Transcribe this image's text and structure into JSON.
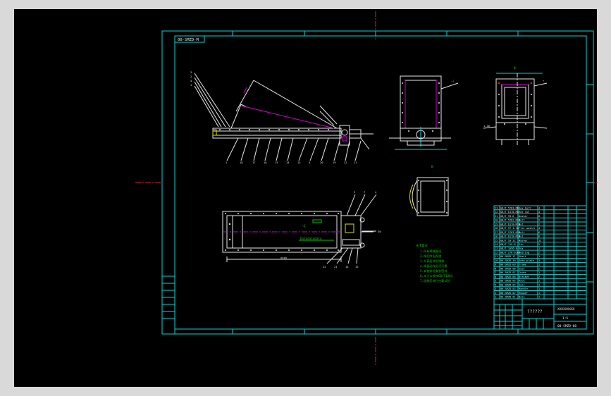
{
  "frame": {
    "label": "00-SMZD-M"
  },
  "bom": {
    "rows": [
      {
        "num": "23",
        "code": "GB/T 5783-M8",
        "name": "Hex bolt",
        "qty": "4"
      },
      {
        "num": "22",
        "code": "GB/T 6170-M8",
        "name": "Hex nut",
        "qty": "4"
      },
      {
        "num": "21",
        "code": "GB/T 93-8",
        "name": "Washer",
        "qty": "8"
      },
      {
        "num": "20",
        "code": "GB/T 5782-M10",
        "name": "Bolt",
        "qty": "2"
      },
      {
        "num": "19",
        "code": "GB/T 6170-M10",
        "name": "Nut",
        "qty": "2"
      },
      {
        "num": "18",
        "code": "GB/T 97.1-10",
        "name": "Flat washer",
        "qty": "4"
      },
      {
        "num": "17",
        "code": "GB/T 5783-M12",
        "name": "Bolt",
        "qty": "6"
      },
      {
        "num": "16",
        "code": "GB/T 6170-M12",
        "name": "Nut",
        "qty": "6"
      },
      {
        "num": "15",
        "code": "GB/T 93-12",
        "name": "Washer",
        "qty": "12"
      },
      {
        "num": "14",
        "code": "GB/T 119-8",
        "name": "Pin",
        "qty": "2"
      },
      {
        "num": "13",
        "code": "GB/T 1096-8",
        "name": "Key",
        "qty": "1"
      },
      {
        "num": "12",
        "code": "GB/T 276-6205",
        "name": "Bearing",
        "qty": "2"
      },
      {
        "num": "11",
        "code": "00-SMZD-11",
        "name": "Shaft",
        "qty": "1"
      },
      {
        "num": "10",
        "code": "00-SMZD-10",
        "name": "Gate plate",
        "qty": "1"
      },
      {
        "num": "9",
        "code": "00-SMZD-09",
        "name": "Frame",
        "qty": "1"
      },
      {
        "num": "8",
        "code": "00-SMZD-08",
        "name": "Seal",
        "qty": "2"
      },
      {
        "num": "7",
        "code": "00-SMZD-07",
        "name": "Cover",
        "qty": "1"
      },
      {
        "num": "6",
        "code": "00-SMZD-06",
        "name": "Bracket",
        "qty": "2"
      },
      {
        "num": "5",
        "code": "00-SMZD-05",
        "name": "Rack",
        "qty": "1"
      },
      {
        "num": "4",
        "code": "00-SMZD-04",
        "name": "Gear",
        "qty": "1"
      },
      {
        "num": "3",
        "code": "00-SMZD-03",
        "name": "Handle",
        "qty": "1"
      },
      {
        "num": "2",
        "code": "00-SMZD-02",
        "name": "Hopper",
        "qty": "1"
      },
      {
        "num": "1",
        "code": "00-SMZD-01",
        "name": "Base",
        "qty": "1"
      }
    ]
  },
  "title_block": {
    "title": "??????",
    "code": "00-SMZD-00",
    "company": "XXXXXXXXX",
    "scale": "1:5"
  }
}
